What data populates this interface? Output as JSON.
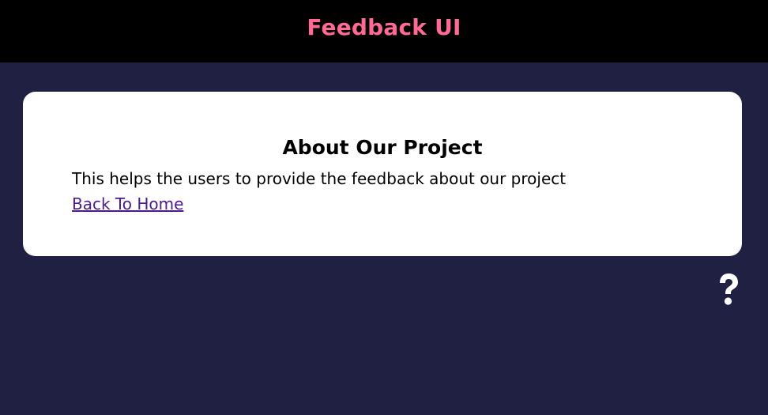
{
  "header": {
    "title": "Feedback UI",
    "title_color": "#ff6a95",
    "background": "#000000"
  },
  "page": {
    "background": "#202142"
  },
  "about_card": {
    "title": "About Our Project",
    "description": "This helps the users to provide the feedback about our project",
    "link_label": "Back To Home",
    "link_color": "#4b1a8c"
  },
  "help": {
    "icon": "question-icon",
    "color": "#ffffff"
  }
}
